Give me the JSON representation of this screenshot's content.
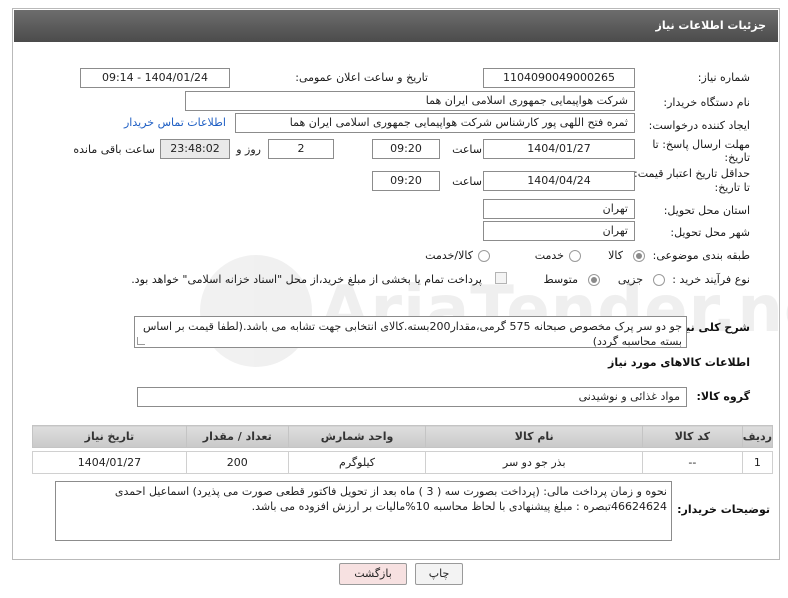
{
  "header": {
    "title": "جزئیات اطلاعات نیاز"
  },
  "fields": {
    "need_number_label": "شماره نیاز:",
    "need_number": "1104090049000265",
    "announce_label": "تاریخ و ساعت اعلان عمومی:",
    "announce_value": "1404/01/24 - 09:14",
    "buyer_org_label": "نام دستگاه خریدار:",
    "buyer_org": "شرکت هواپیمایی جمهوری اسلامی ایران هما",
    "creator_label": "ایجاد کننده درخواست:",
    "creator": "ثمره فتح اللهی پور کارشناس شرکت هواپیمایی جمهوری اسلامی ایران هما",
    "contact_link": "اطلاعات تماس خریدار",
    "deadline_label_1": "مهلت ارسال پاسخ: تا",
    "deadline_label_2": "تاریخ:",
    "deadline_date": "1404/01/27",
    "time_label": "ساعت",
    "deadline_time": "09:20",
    "days_value": "2",
    "days_label": "روز و",
    "remaining_time": "23:48:02",
    "remaining_label": "ساعت باقی مانده",
    "validity_label_1": "حداقل تاریخ اعتبار قیمت:",
    "validity_label_2": "تا تاریخ:",
    "validity_date": "1404/04/24",
    "validity_time": "09:20",
    "province_label": "استان محل تحویل:",
    "province": "تهران",
    "city_label": "شهر محل تحویل:",
    "city": "تهران",
    "category_label": "طبقه بندی موضوعی:",
    "category_options": [
      "کالا",
      "خدمت",
      "کالا/خدمت"
    ],
    "process_label": "نوع فرآیند خرید :",
    "process_options": [
      "جزیی",
      "متوسط"
    ],
    "payment_note": "پرداخت تمام یا بخشی از مبلغ خرید،از محل \"اسناد خزانه اسلامی\" خواهد بود."
  },
  "description": {
    "label": "شرح کلی نیاز:",
    "text": "جو دو سر پرک مخصوص صبحانه 575 گرمی،مقدار200بسته.کالای انتخابی جهت تشابه می باشد.(لطفا قیمت بر اساس بسته محاسبه گردد)"
  },
  "goods_section": {
    "title": "اطلاعات کالاهای مورد نیاز",
    "group_label": "گروه کالا:",
    "group_value": "مواد غذائی و نوشیدنی"
  },
  "table": {
    "columns": [
      "ردیف",
      "کد کالا",
      "نام کالا",
      "واحد شمارش",
      "تعداد / مقدار",
      "تاریخ نیاز"
    ],
    "rows": [
      [
        "1",
        "--",
        "بذر جو دو سر",
        "کیلوگرم",
        "200",
        "1404/01/27"
      ]
    ]
  },
  "buyer_notes": {
    "label": "توضیحات خریدار:",
    "text": "نحوه و زمان پرداخت مالی:  (پرداخت بصورت سه ( 3 ) ماه بعد از تحویل فاکتور قطعی  صورت می پذیرد) اسماعیل احمدی 46624624تبصره : مبلغ پیشنهادی با لحاظ محاسبه 10%مالیات بر ارزش افزوده می باشد."
  },
  "buttons": {
    "print": "چاپ",
    "back": "بازگشت"
  },
  "watermark": "AriaTender.neT",
  "colors": {
    "title_bar": "#5a5a5a",
    "link": "#1f5fc4",
    "back_button": "#f7e1e1"
  }
}
